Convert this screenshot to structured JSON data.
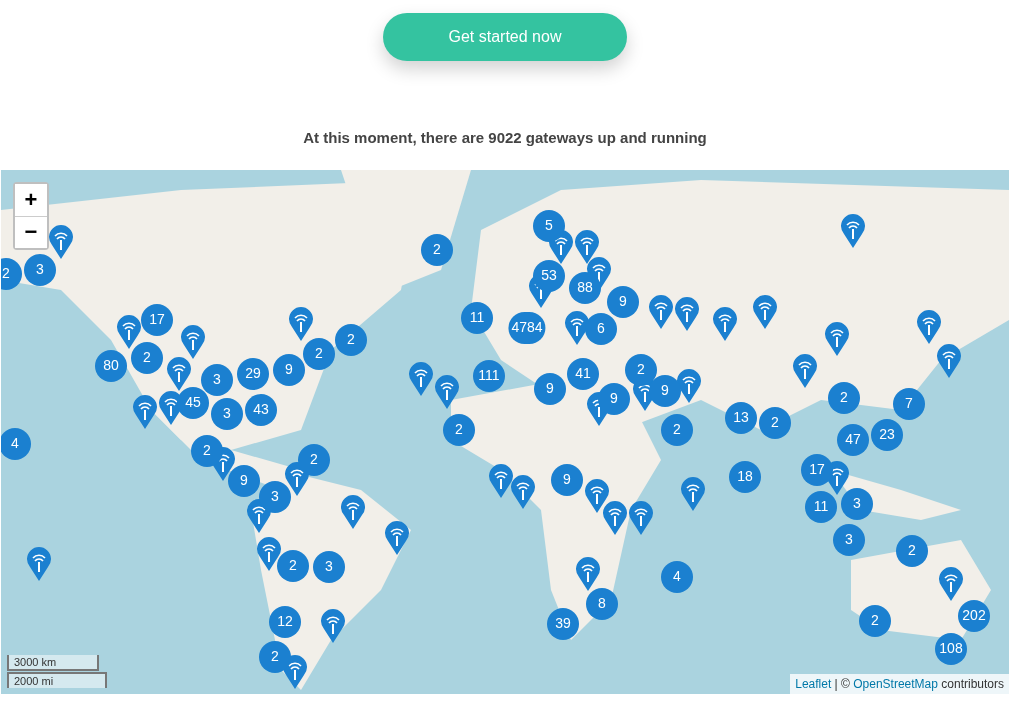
{
  "cta_button": {
    "label": "Get started now"
  },
  "heading": "At this moment, there are 9022 gateways up and running",
  "map": {
    "kind": "picture",
    "zoom_controls": [
      "+",
      "−"
    ],
    "clusters": [
      {
        "count": "2"
      },
      {
        "count": "3"
      },
      {
        "count": "2"
      },
      {
        "count": "5"
      },
      {
        "count": "53"
      },
      {
        "count": "88"
      },
      {
        "count": "9"
      },
      {
        "count": "11"
      },
      {
        "count": "4784"
      },
      {
        "count": "17"
      },
      {
        "count": "80"
      },
      {
        "count": "2"
      },
      {
        "count": "29"
      },
      {
        "count": "9"
      },
      {
        "count": "2"
      },
      {
        "count": "2"
      },
      {
        "count": "3"
      },
      {
        "count": "45"
      },
      {
        "count": "3"
      },
      {
        "count": "43"
      },
      {
        "count": "111"
      },
      {
        "count": "41"
      },
      {
        "count": "9"
      },
      {
        "count": "2"
      },
      {
        "count": "9"
      },
      {
        "count": "9"
      },
      {
        "count": "2"
      },
      {
        "count": "2"
      },
      {
        "count": "13"
      },
      {
        "count": "2"
      },
      {
        "count": "2"
      },
      {
        "count": "7"
      },
      {
        "count": "47"
      },
      {
        "count": "23"
      },
      {
        "count": "4"
      },
      {
        "count": "2"
      },
      {
        "count": "2"
      },
      {
        "count": "9"
      },
      {
        "count": "3"
      },
      {
        "count": "9"
      },
      {
        "count": "18"
      },
      {
        "count": "17"
      },
      {
        "count": "11"
      },
      {
        "count": "3"
      },
      {
        "count": "3"
      },
      {
        "count": "2"
      },
      {
        "count": "2"
      },
      {
        "count": "3"
      },
      {
        "count": "12"
      },
      {
        "count": "2"
      },
      {
        "count": "4"
      },
      {
        "count": "8"
      },
      {
        "count": "39"
      },
      {
        "count": "2"
      },
      {
        "count": "202"
      },
      {
        "count": "108"
      },
      {
        "count": "6"
      }
    ],
    "scale": [
      "3000 km",
      "2000 mi"
    ],
    "attribution": [
      {
        "kind": "link",
        "text": "Leaflet"
      },
      {
        "kind": "text",
        "text": " | © "
      },
      {
        "kind": "link",
        "text": "OpenStreetMap"
      },
      {
        "kind": "text",
        "text": " contributors"
      }
    ]
  }
}
